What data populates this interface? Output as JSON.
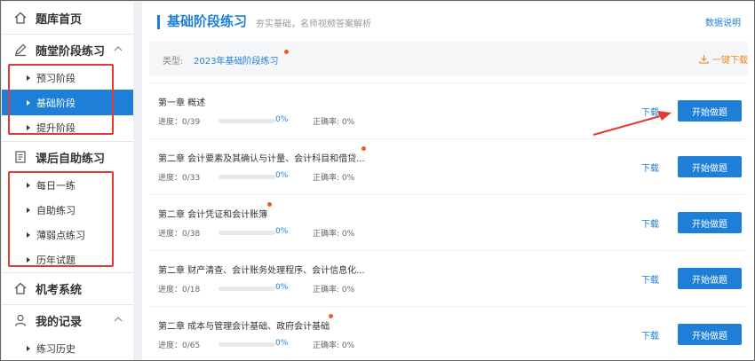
{
  "sidebar": {
    "home": {
      "label": "题库首页",
      "icon": "home-icon"
    },
    "section1": {
      "label": "随堂阶段练习",
      "icon": "pencil-icon",
      "items": [
        {
          "label": "预习阶段"
        },
        {
          "label": "基础阶段"
        },
        {
          "label": "提升阶段"
        }
      ]
    },
    "section2": {
      "label": "课后自助练习",
      "icon": "notebook-icon",
      "items": [
        {
          "label": "每日一练"
        },
        {
          "label": "自助练习"
        },
        {
          "label": "薄弱点练习"
        },
        {
          "label": "历年试题"
        }
      ]
    },
    "exam": {
      "label": "机考系统",
      "icon": "home-icon"
    },
    "records": {
      "label": "我的记录",
      "icon": "user-icon",
      "items": [
        {
          "label": "练习历史"
        }
      ]
    }
  },
  "header": {
    "title": "基础阶段练习",
    "subtitle": "夯实基础，名师视频答案解析",
    "data_desc": "数据说明"
  },
  "type_bar": {
    "label": "类型:",
    "value": "2023年基础阶段练习",
    "download_all": "一键下载"
  },
  "colors": {
    "accent": "#1e7fd9",
    "dot": "#f05a28",
    "download_orange": "#f08c2a",
    "annotation_red": "#e53935"
  },
  "chapters": [
    {
      "title": "第一章 概述",
      "progress": "进度：0/39",
      "percent": "0%",
      "accuracy": "正确率: 0%",
      "download": "下载",
      "start": "开始做题",
      "dot": false
    },
    {
      "title": "第二章 会计要素及其确认与计量、会计科目和借贷...",
      "progress": "进度：0/33",
      "percent": "0%",
      "accuracy": "正确率: 0%",
      "download": "下载",
      "start": "开始做题",
      "dot": true
    },
    {
      "title": "第二章 会计凭证和会计账簿",
      "progress": "进度：0/38",
      "percent": "0%",
      "accuracy": "正确率: 0%",
      "download": "下载",
      "start": "开始做题",
      "dot": true
    },
    {
      "title": "第二章 财产清查、会计账务处理程序、会计信息化...",
      "progress": "进度：0/18",
      "percent": "0%",
      "accuracy": "正确率: 0%",
      "download": "下载",
      "start": "开始做题",
      "dot": false
    },
    {
      "title": "第二章 成本与管理会计基础、政府会计基础",
      "progress": "进度：0/65",
      "percent": "0%",
      "accuracy": "正确率: 0%",
      "download": "下载",
      "start": "开始做题",
      "dot": true
    }
  ]
}
